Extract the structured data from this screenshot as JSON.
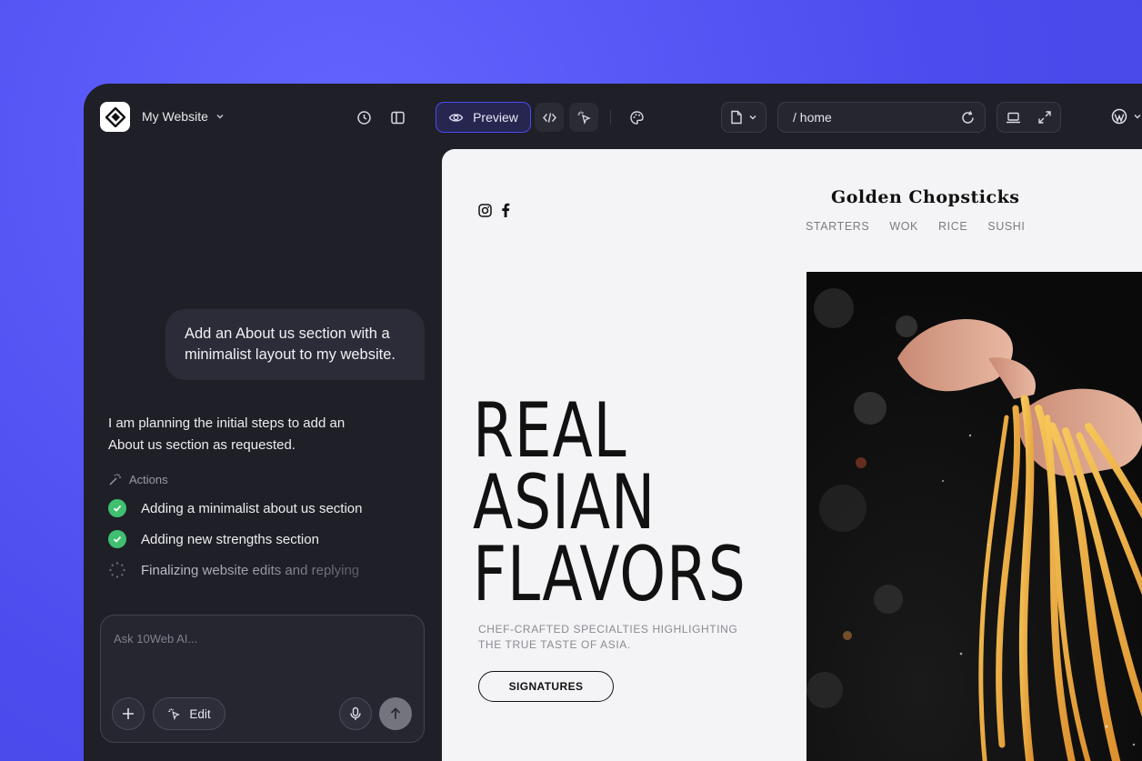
{
  "topbar": {
    "site_name": "My Website",
    "preview_label": "Preview",
    "url": "/ home"
  },
  "chat": {
    "user_message": "Add an About us section with a minimalist layout to my website.",
    "ai_message": "I am planning the initial steps to add an About us section as requested.",
    "actions_label": "Actions",
    "actions": [
      {
        "label": "Adding a minimalist about us section",
        "status": "done"
      },
      {
        "label": "Adding new strengths section",
        "status": "done"
      },
      {
        "label": "Finalizing website edits and replying",
        "status": "pending"
      }
    ],
    "composer_placeholder": "Ask 10Web AI...",
    "edit_label": "Edit"
  },
  "site": {
    "brand": "Golden Chopsticks",
    "nav": [
      "STARTERS",
      "WOK",
      "RICE",
      "SUSHI"
    ],
    "hero_lines": [
      "REAL",
      "ASIAN",
      "FLAVORS"
    ],
    "hero_sub_1": "CHEF-CRAFTED SPECIALTIES HIGHLIGHTING",
    "hero_sub_2": "THE TRUE TASTE OF ASIA.",
    "cta_label": "SIGNATURES"
  },
  "colors": {
    "background": "#5454f2",
    "panel": "#1f1f28",
    "accent": "#4a4af0",
    "success": "#3fbf6f",
    "canvas": "#f4f4f6"
  }
}
